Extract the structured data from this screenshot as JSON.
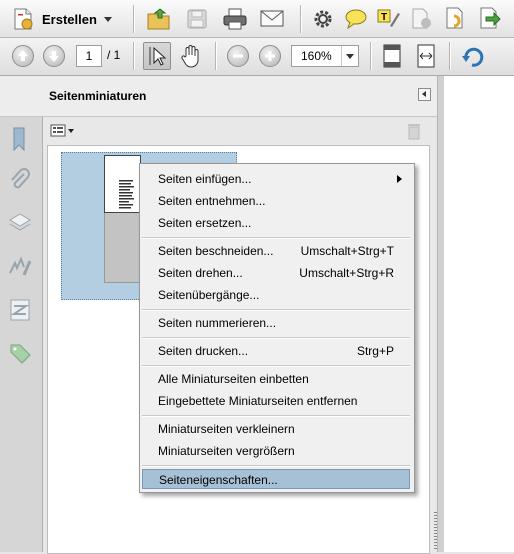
{
  "toolbar": {
    "create_label": "Erstellen",
    "page_current": "1",
    "page_total": "/ 1",
    "zoom": "160%"
  },
  "sidebar": {
    "panel_title": "Seitenminiaturen",
    "icons": [
      "page-icon",
      "bookmark-icon",
      "paperclip-icon",
      "layers-icon",
      "signature-icon",
      "article-icon",
      "tag-icon"
    ]
  },
  "context_menu": {
    "items": [
      {
        "label": "Seiten einfügen...",
        "shortcut": "",
        "submenu": true
      },
      {
        "label": "Seiten entnehmen...",
        "shortcut": ""
      },
      {
        "label": "Seiten ersetzen...",
        "shortcut": ""
      },
      {
        "label": "Seiten beschneiden...",
        "shortcut": "Umschalt+Strg+T"
      },
      {
        "label": "Seiten drehen...",
        "shortcut": "Umschalt+Strg+R"
      },
      {
        "label": "Seitenübergänge...",
        "shortcut": ""
      },
      {
        "label": "Seiten nummerieren...",
        "shortcut": ""
      },
      {
        "label": "Seiten drucken...",
        "shortcut": "Strg+P"
      },
      {
        "label": "Alle Miniaturseiten einbetten",
        "shortcut": ""
      },
      {
        "label": "Eingebettete Miniaturseiten entfernen",
        "shortcut": ""
      },
      {
        "label": "Miniaturseiten verkleinern",
        "shortcut": ""
      },
      {
        "label": "Miniaturseiten vergrößern",
        "shortcut": ""
      },
      {
        "label": "Seiteneigenschaften...",
        "shortcut": "",
        "active": true
      }
    ]
  },
  "colors": {
    "selection": "#b3cde1",
    "menu_highlight": "#a6c0d6"
  }
}
